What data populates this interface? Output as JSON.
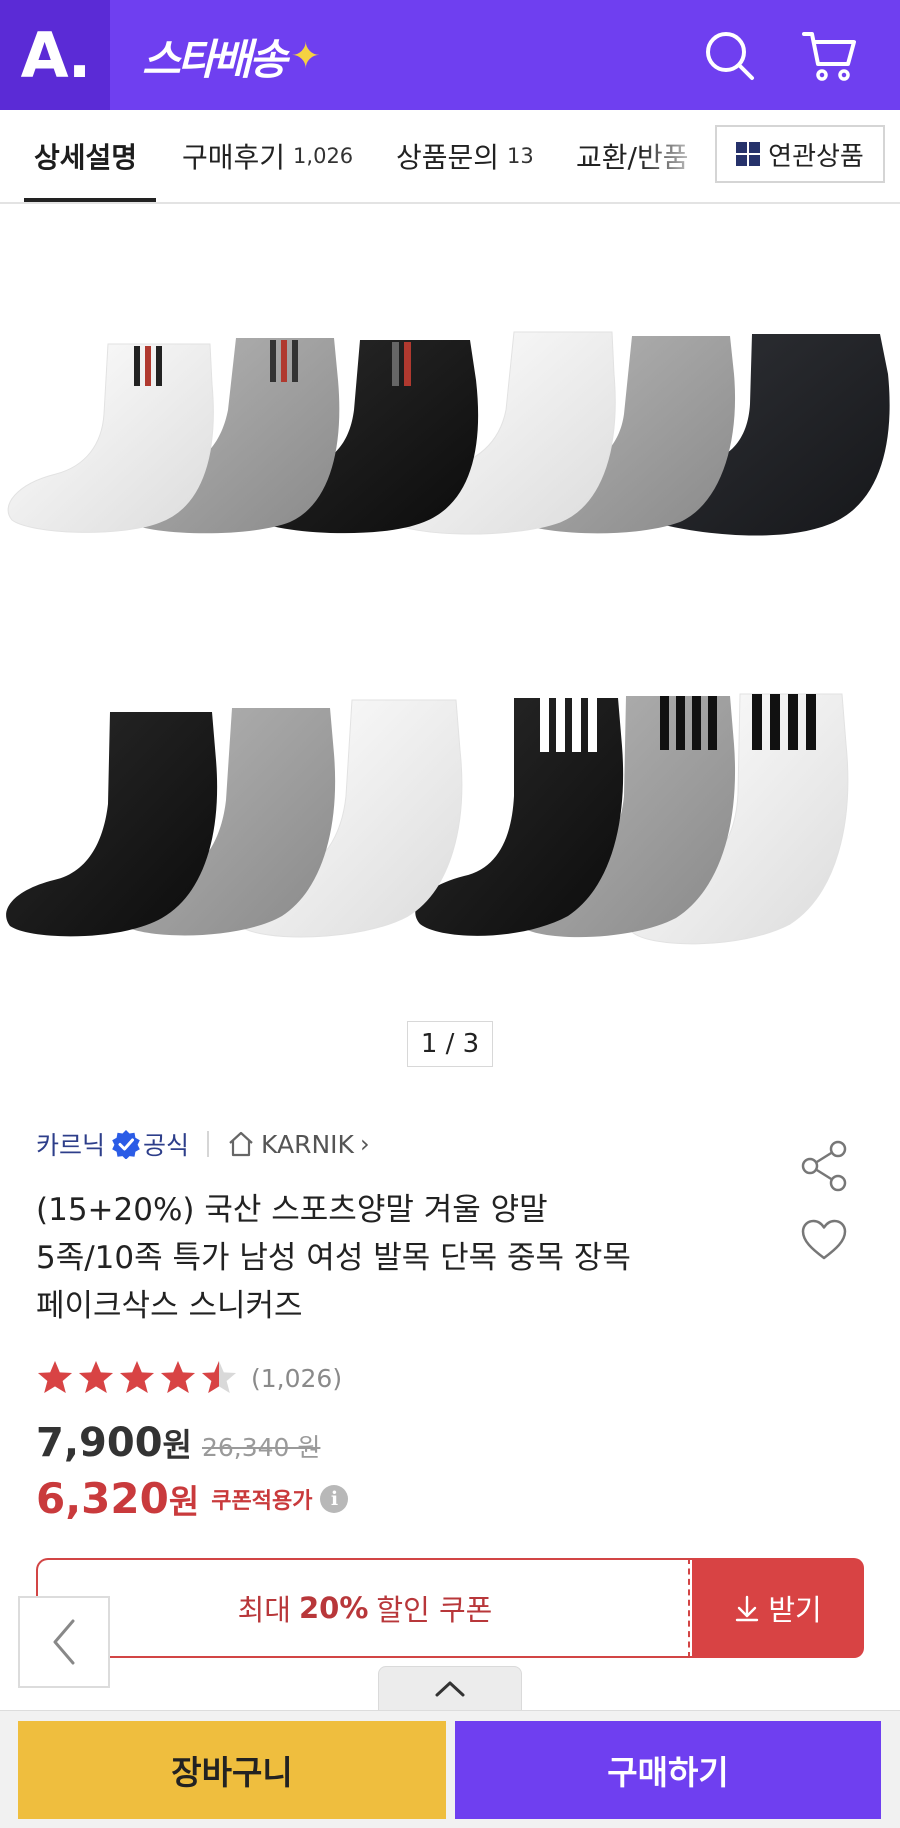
{
  "header": {
    "logo": "A.",
    "brand": "스타배송",
    "brand_sparkle": "✦",
    "icons": [
      "search-icon",
      "cart-icon"
    ],
    "color": "#6f3ff0"
  },
  "tabs": [
    {
      "label": "상세설명",
      "count": ""
    },
    {
      "label": "구매후기",
      "count": "1,026"
    },
    {
      "label": "상품문의",
      "count": "13"
    },
    {
      "label": "교환/반품",
      "count": ""
    }
  ],
  "related_button": {
    "label": "연관상품",
    "icon": "grid-icon"
  },
  "gallery": {
    "counter": "1 / 3",
    "sock_rows": [
      [
        "white-stripe",
        "gray-stripe",
        "black-stripe",
        "white",
        "gray",
        "black"
      ],
      [
        "black",
        "gray",
        "white",
        "black-bars",
        "gray-bars",
        "white-bars"
      ]
    ]
  },
  "seller": {
    "name": "카르닉",
    "official": "공식",
    "store": "KARNIK"
  },
  "product": {
    "title_lines": [
      "(15+20%) 국산 스포츠양말 겨울 양말",
      "5족/10족 특가 남성 여성 발목 단목 중목 장목",
      "페이크삭스 스니커즈"
    ]
  },
  "rating": {
    "value": 4.5,
    "max": 5,
    "count": "(1,026)",
    "color": "#d84344"
  },
  "price": {
    "sale": "7,900",
    "unit": "원",
    "original": "26,340 원",
    "coupon_price": "6,320",
    "coupon_unit": "원",
    "coupon_label": "쿠폰적용가",
    "info_icon": "i"
  },
  "coupon": {
    "prefix": "최대",
    "percent": "20%",
    "suffix": "할인 쿠폰",
    "download": "받기"
  },
  "bottom": {
    "cart": "장바구니",
    "buy": "구매하기"
  }
}
